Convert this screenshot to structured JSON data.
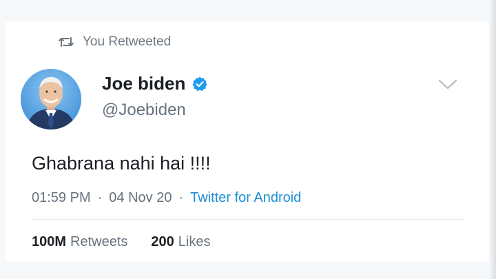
{
  "retweet_banner": {
    "icon": "retweet-icon",
    "label": "You Retweeted"
  },
  "author": {
    "name": "Joe biden",
    "handle": "@Joebiden",
    "verified": true,
    "verified_color": "#1d9bf0"
  },
  "tweet": {
    "text": "Ghabrana nahi hai !!!!",
    "time": "01:59 PM",
    "date": "04 Nov 20",
    "separator": "·",
    "source": "Twitter for Android",
    "source_color": "#1d8fd5"
  },
  "stats": {
    "retweets_count": "100M",
    "retweets_label": "Retweets",
    "likes_count": "200",
    "likes_label": "Likes"
  }
}
